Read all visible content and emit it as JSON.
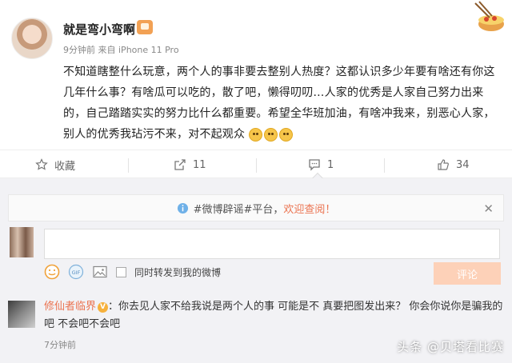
{
  "post": {
    "username": "就是弯小弯啊",
    "time": "9分钟前",
    "source_prefix": "来自",
    "source": "iPhone 11 Pro",
    "text": "不知道瞎整什么玩意，两个人的事非要去整别人热度？这都认识多少年要有啥还有你这几年什么事？有啥瓜可以吃的，散了吧，懒得叨叨…人家的优秀是人家自己努力出来的，自己踏踏实实的努力比什么都重要。希望全华班加油，有啥冲我来，别恶心人家，别人的优秀我玷污不来，对不起观众",
    "emoji_count": 3
  },
  "actions": {
    "favorite_label": "收藏",
    "forward_count": "11",
    "comment_count": "1",
    "like_count": "34"
  },
  "comment_box": {
    "notice_prefix": "#微博辟谣#平台，",
    "notice_link": "欢迎查阅！",
    "input_value": "",
    "forward_option": "同时转发到我的微博",
    "submit_label": "评论"
  },
  "reply": {
    "username": "修仙者临界",
    "badge": "V",
    "text": "：你去见人家不给我说是两个人的事  可能是不  真要把图发出来？  你会你说你是骗我的吧  不会吧不会吧",
    "time": "7分钟前"
  },
  "watermark": "头条 @贝塔看比赛",
  "colors": {
    "accent": "#eb7350",
    "badge": "#f6b13d",
    "submit_disabled": "#fdd1b8"
  }
}
